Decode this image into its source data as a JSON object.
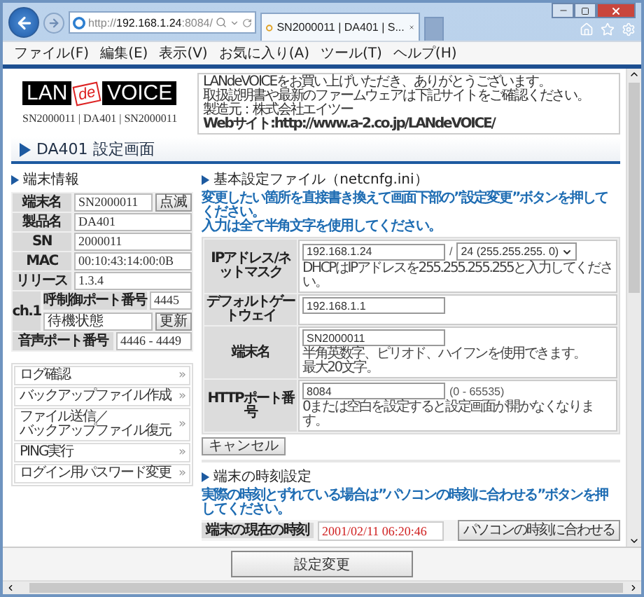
{
  "browser": {
    "address": {
      "scheme": "http://",
      "host": "192.168.1.24",
      "rest": ":8084/"
    },
    "tab": {
      "title": "SN2000011 | DA401 | S...",
      "selected": true
    },
    "menu": [
      "ファイル(F)",
      "編集(E)",
      "表示(V)",
      "お気に入り(A)",
      "ツール(T)",
      "ヘルプ(H)"
    ]
  },
  "header": {
    "logo": {
      "left": "LAN",
      "middle": "de",
      "right": "VOICE"
    },
    "path": "SN2000011 | DA401 | SN2000011",
    "notice": [
      "LANdeVOICEをお買い上げいただき、ありがとうございます。",
      "取扱説明書や最新のファームウェアは下記サイトをご確認ください。",
      "製造元：株式会社エイツー",
      "**Webサイト:http://www.a-2.co.jp/LANdeVOICE/**"
    ]
  },
  "page_title": "DA401 設定画面",
  "terminal_info": {
    "heading": "端末情報",
    "rows": [
      {
        "label": "端末名",
        "value": "SN2000011",
        "button": "点滅"
      },
      {
        "label": "製品名",
        "value": "DA401"
      },
      {
        "label": "SN",
        "value": "2000011"
      },
      {
        "label": "MAC",
        "value": "00:10:43:14:00:0B"
      },
      {
        "label": "リリース",
        "value": "1.3.4"
      }
    ],
    "channel": {
      "label": "ch.1",
      "port_label": "呼制御ポート番号",
      "port": "4445",
      "status": "待機状態",
      "button": "更新"
    },
    "voice_port": {
      "label": "音声ポート番号",
      "value": "4446 - 4449"
    }
  },
  "side_menu": [
    {
      "label": [
        "ログ確認"
      ],
      "arrow": "»"
    },
    {
      "label": [
        "バックアップファイル作成"
      ],
      "arrow": "»"
    },
    {
      "label": [
        "ファイル送信／",
        "バックアップファイル復元"
      ],
      "arrow": "»"
    },
    {
      "label": [
        "PING実行"
      ],
      "arrow": "»"
    },
    {
      "label": [
        "ログイン用パスワード変更"
      ],
      "arrow": "»"
    }
  ],
  "basic_settings": {
    "heading": "基本設定ファイル（netcnfg.ini）",
    "instructions": [
      "変更したい箇所を直接書き換えて画面下部の”設定変更”ボタンを押してください。",
      "入力は全て半角文字を使用してください。"
    ],
    "fields": [
      {
        "kind": "netmask",
        "label": "IPアドレス/ネットマスク",
        "value": "192.168.1.24",
        "separator": "/",
        "select": "24 (255.255.255. 0)",
        "note": [
          "DHCPはIPアドレスを255.255.255.255と入力してください。"
        ]
      },
      {
        "kind": "text",
        "label": "デフォルトゲートウェイ",
        "value": "192.168.1.1"
      },
      {
        "kind": "text",
        "label": "端末名",
        "value": "SN2000011",
        "note": [
          "半角英数字、ピリオド、ハイフンを使用できます。",
          "最大20文字。"
        ]
      },
      {
        "kind": "range",
        "label": "HTTPポート番号",
        "value": "8084",
        "range": "(0 - 65535)",
        "note": [
          "0または空白を設定すると設定画面が開かなくなります。"
        ]
      }
    ],
    "cancel": "キャンセル"
  },
  "time_settings": {
    "heading": "端末の時刻設定",
    "instruction": "実際の時刻とずれている場合は”パソコンの時刻に合わせる”ボタンを押してください。",
    "label": "端末の現在の時刻",
    "value": "2001/02/11 06:20:46",
    "button": "パソコンの時刻に合わせる"
  },
  "submit": "設定変更"
}
